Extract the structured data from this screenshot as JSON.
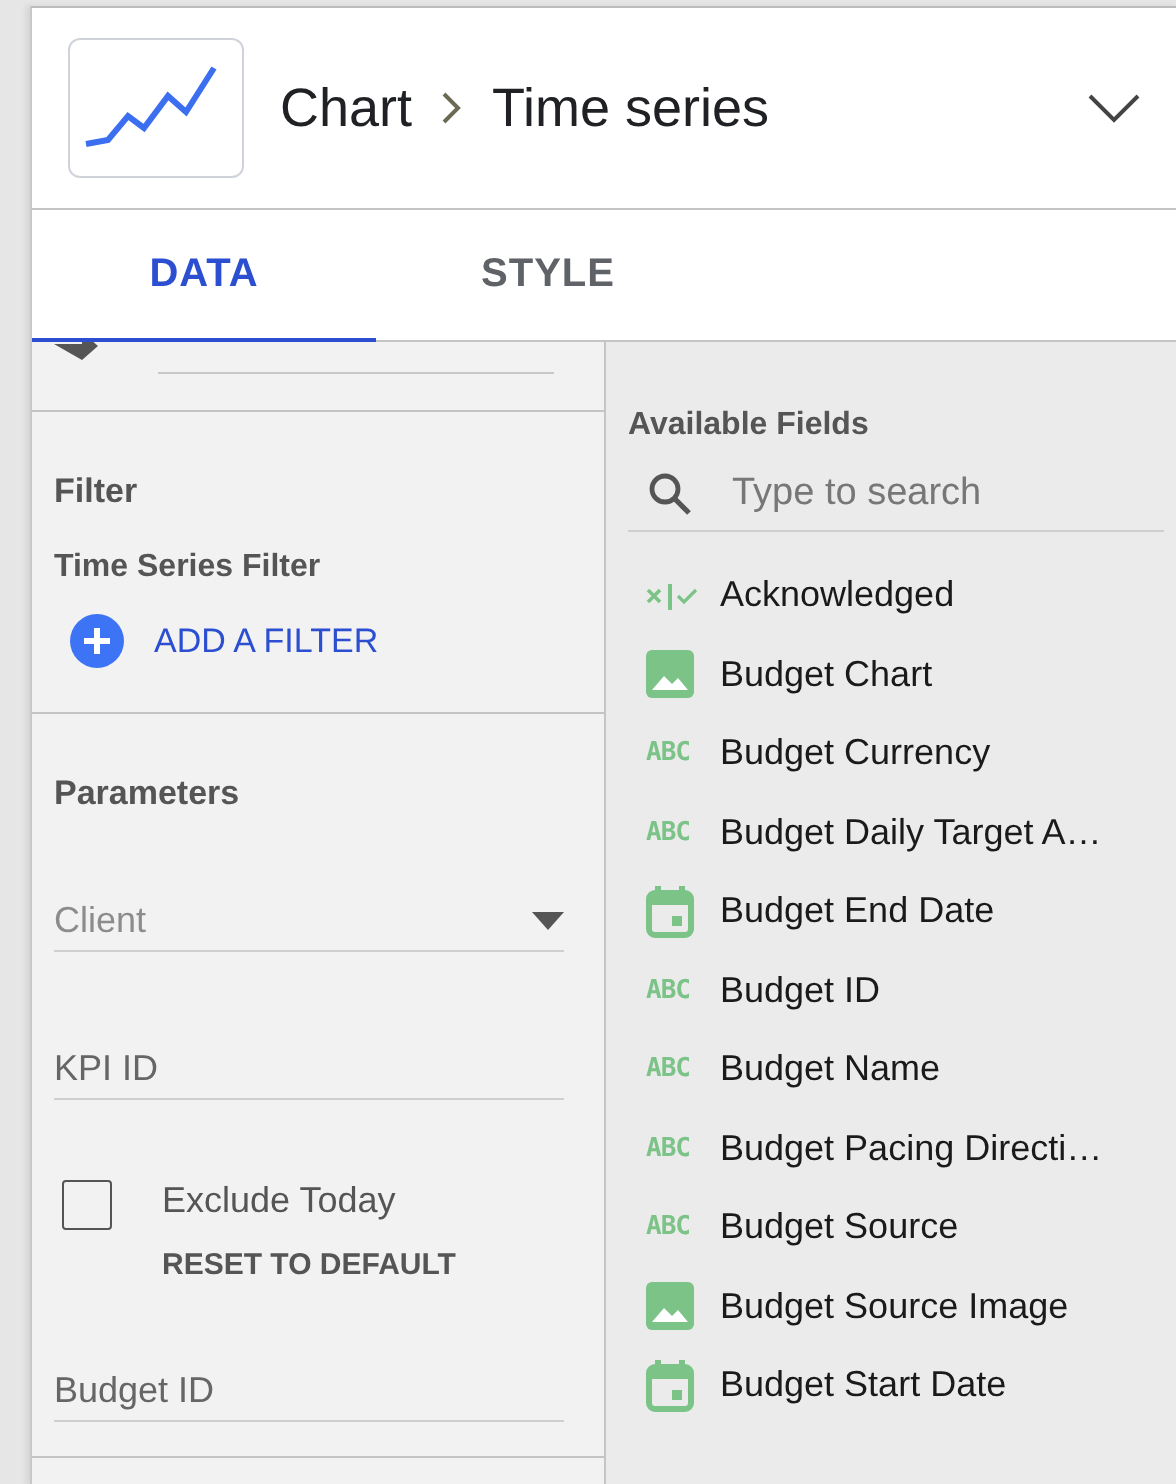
{
  "header": {
    "breadcrumb": [
      "Chart",
      "Time series"
    ]
  },
  "tabs": [
    {
      "label": "DATA",
      "selected": true
    },
    {
      "label": "STYLE",
      "selected": false
    }
  ],
  "filter": {
    "title": "Filter",
    "subtitle": "Time Series Filter",
    "add_button": "ADD A FILTER"
  },
  "parameters": {
    "title": "Parameters",
    "items": [
      {
        "kind": "dropdown",
        "placeholder": "Client"
      },
      {
        "kind": "text",
        "placeholder": "KPI ID"
      },
      {
        "kind": "checkbox",
        "label": "Exclude Today",
        "checked": false,
        "reset": "RESET TO DEFAULT"
      },
      {
        "kind": "text",
        "placeholder": "Budget ID"
      }
    ]
  },
  "available_fields": {
    "title": "Available Fields",
    "search": {
      "placeholder": "Type to search"
    },
    "fields": [
      {
        "kind": "boolean",
        "name": "Acknowledged"
      },
      {
        "kind": "image",
        "name": "Budget Chart"
      },
      {
        "kind": "text",
        "badge": "ABC",
        "name": "Budget Currency"
      },
      {
        "kind": "text",
        "badge": "ABC",
        "name": "Budget Daily Target A…"
      },
      {
        "kind": "date",
        "name": "Budget End Date"
      },
      {
        "kind": "text",
        "badge": "ABC",
        "name": "Budget ID"
      },
      {
        "kind": "text",
        "badge": "ABC",
        "name": "Budget Name"
      },
      {
        "kind": "text",
        "badge": "ABC",
        "name": "Budget Pacing Directi…"
      },
      {
        "kind": "text",
        "badge": "ABC",
        "name": "Budget Source"
      },
      {
        "kind": "image",
        "name": "Budget Source Image"
      },
      {
        "kind": "date",
        "name": "Budget Start Date"
      }
    ]
  }
}
